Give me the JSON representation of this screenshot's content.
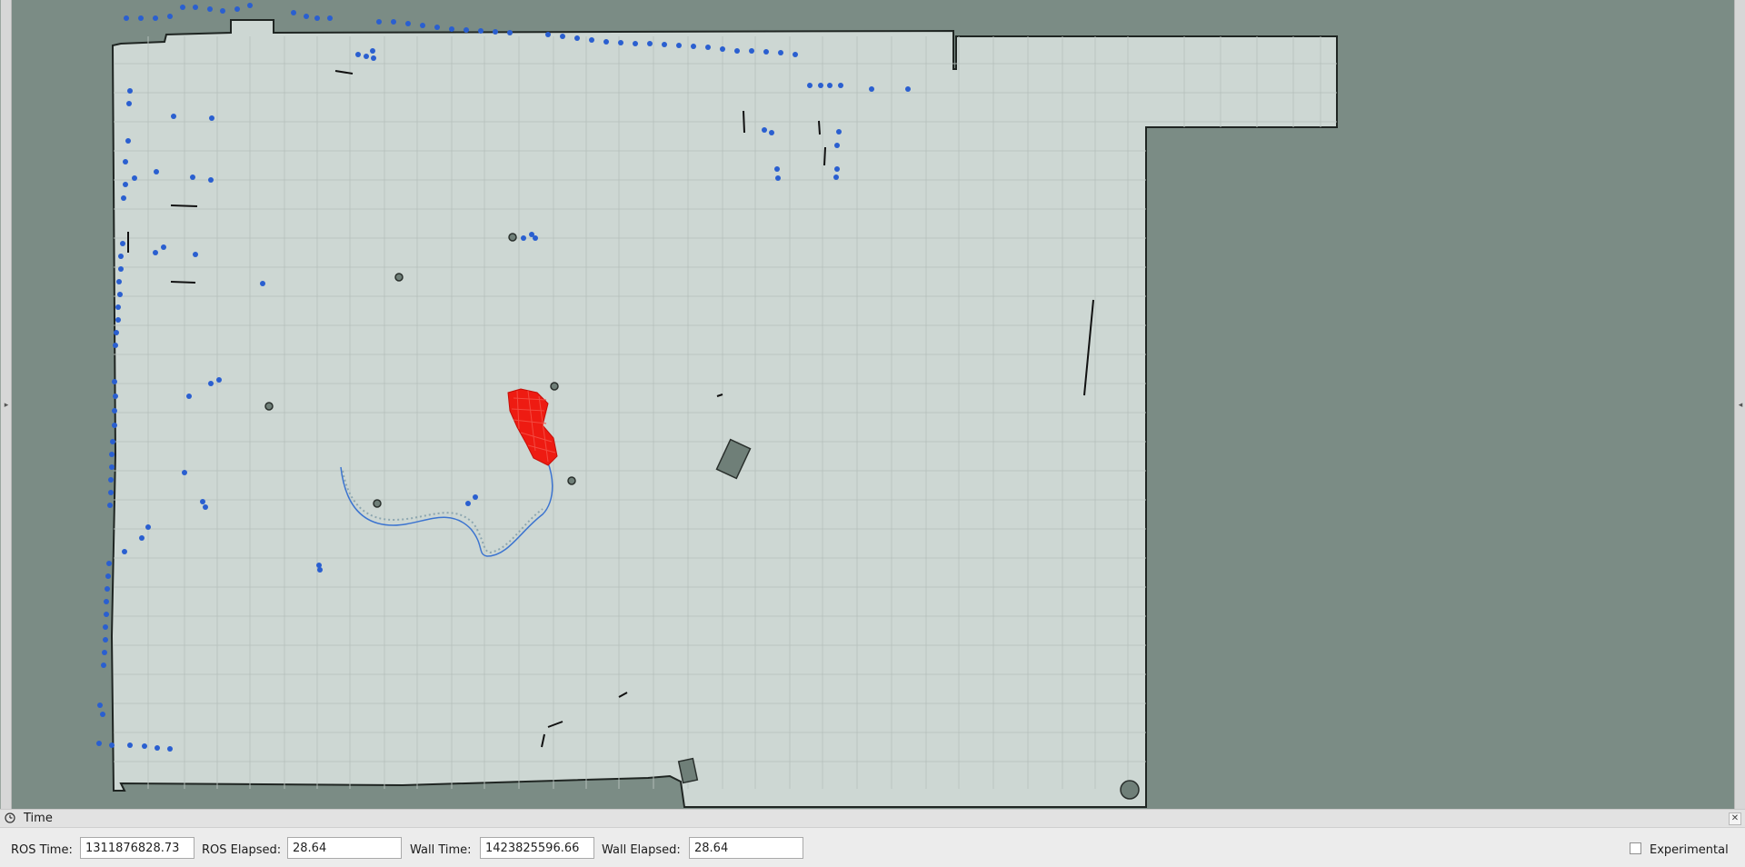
{
  "time_panel": {
    "title": "Time",
    "clock_icon": "clock-icon",
    "close_icon": "close-icon",
    "ros_time_label": "ROS Time:",
    "ros_time_value": "1311876828.73",
    "ros_elapsed_label": "ROS Elapsed:",
    "ros_elapsed_value": "28.64",
    "wall_time_label": "Wall Time:",
    "wall_time_value": "1423825596.66",
    "wall_elapsed_label": "Wall Elapsed:",
    "wall_elapsed_value": "28.64",
    "experimental_label": "Experimental",
    "experimental_checked": false
  },
  "map_view": {
    "background_color": "#7b8c85",
    "free_space_color": "#cfd8d4",
    "laser_point_color": "#2a5fd0",
    "particle_cloud_color": "#ee1b12",
    "path_color": "#3c74d0"
  }
}
